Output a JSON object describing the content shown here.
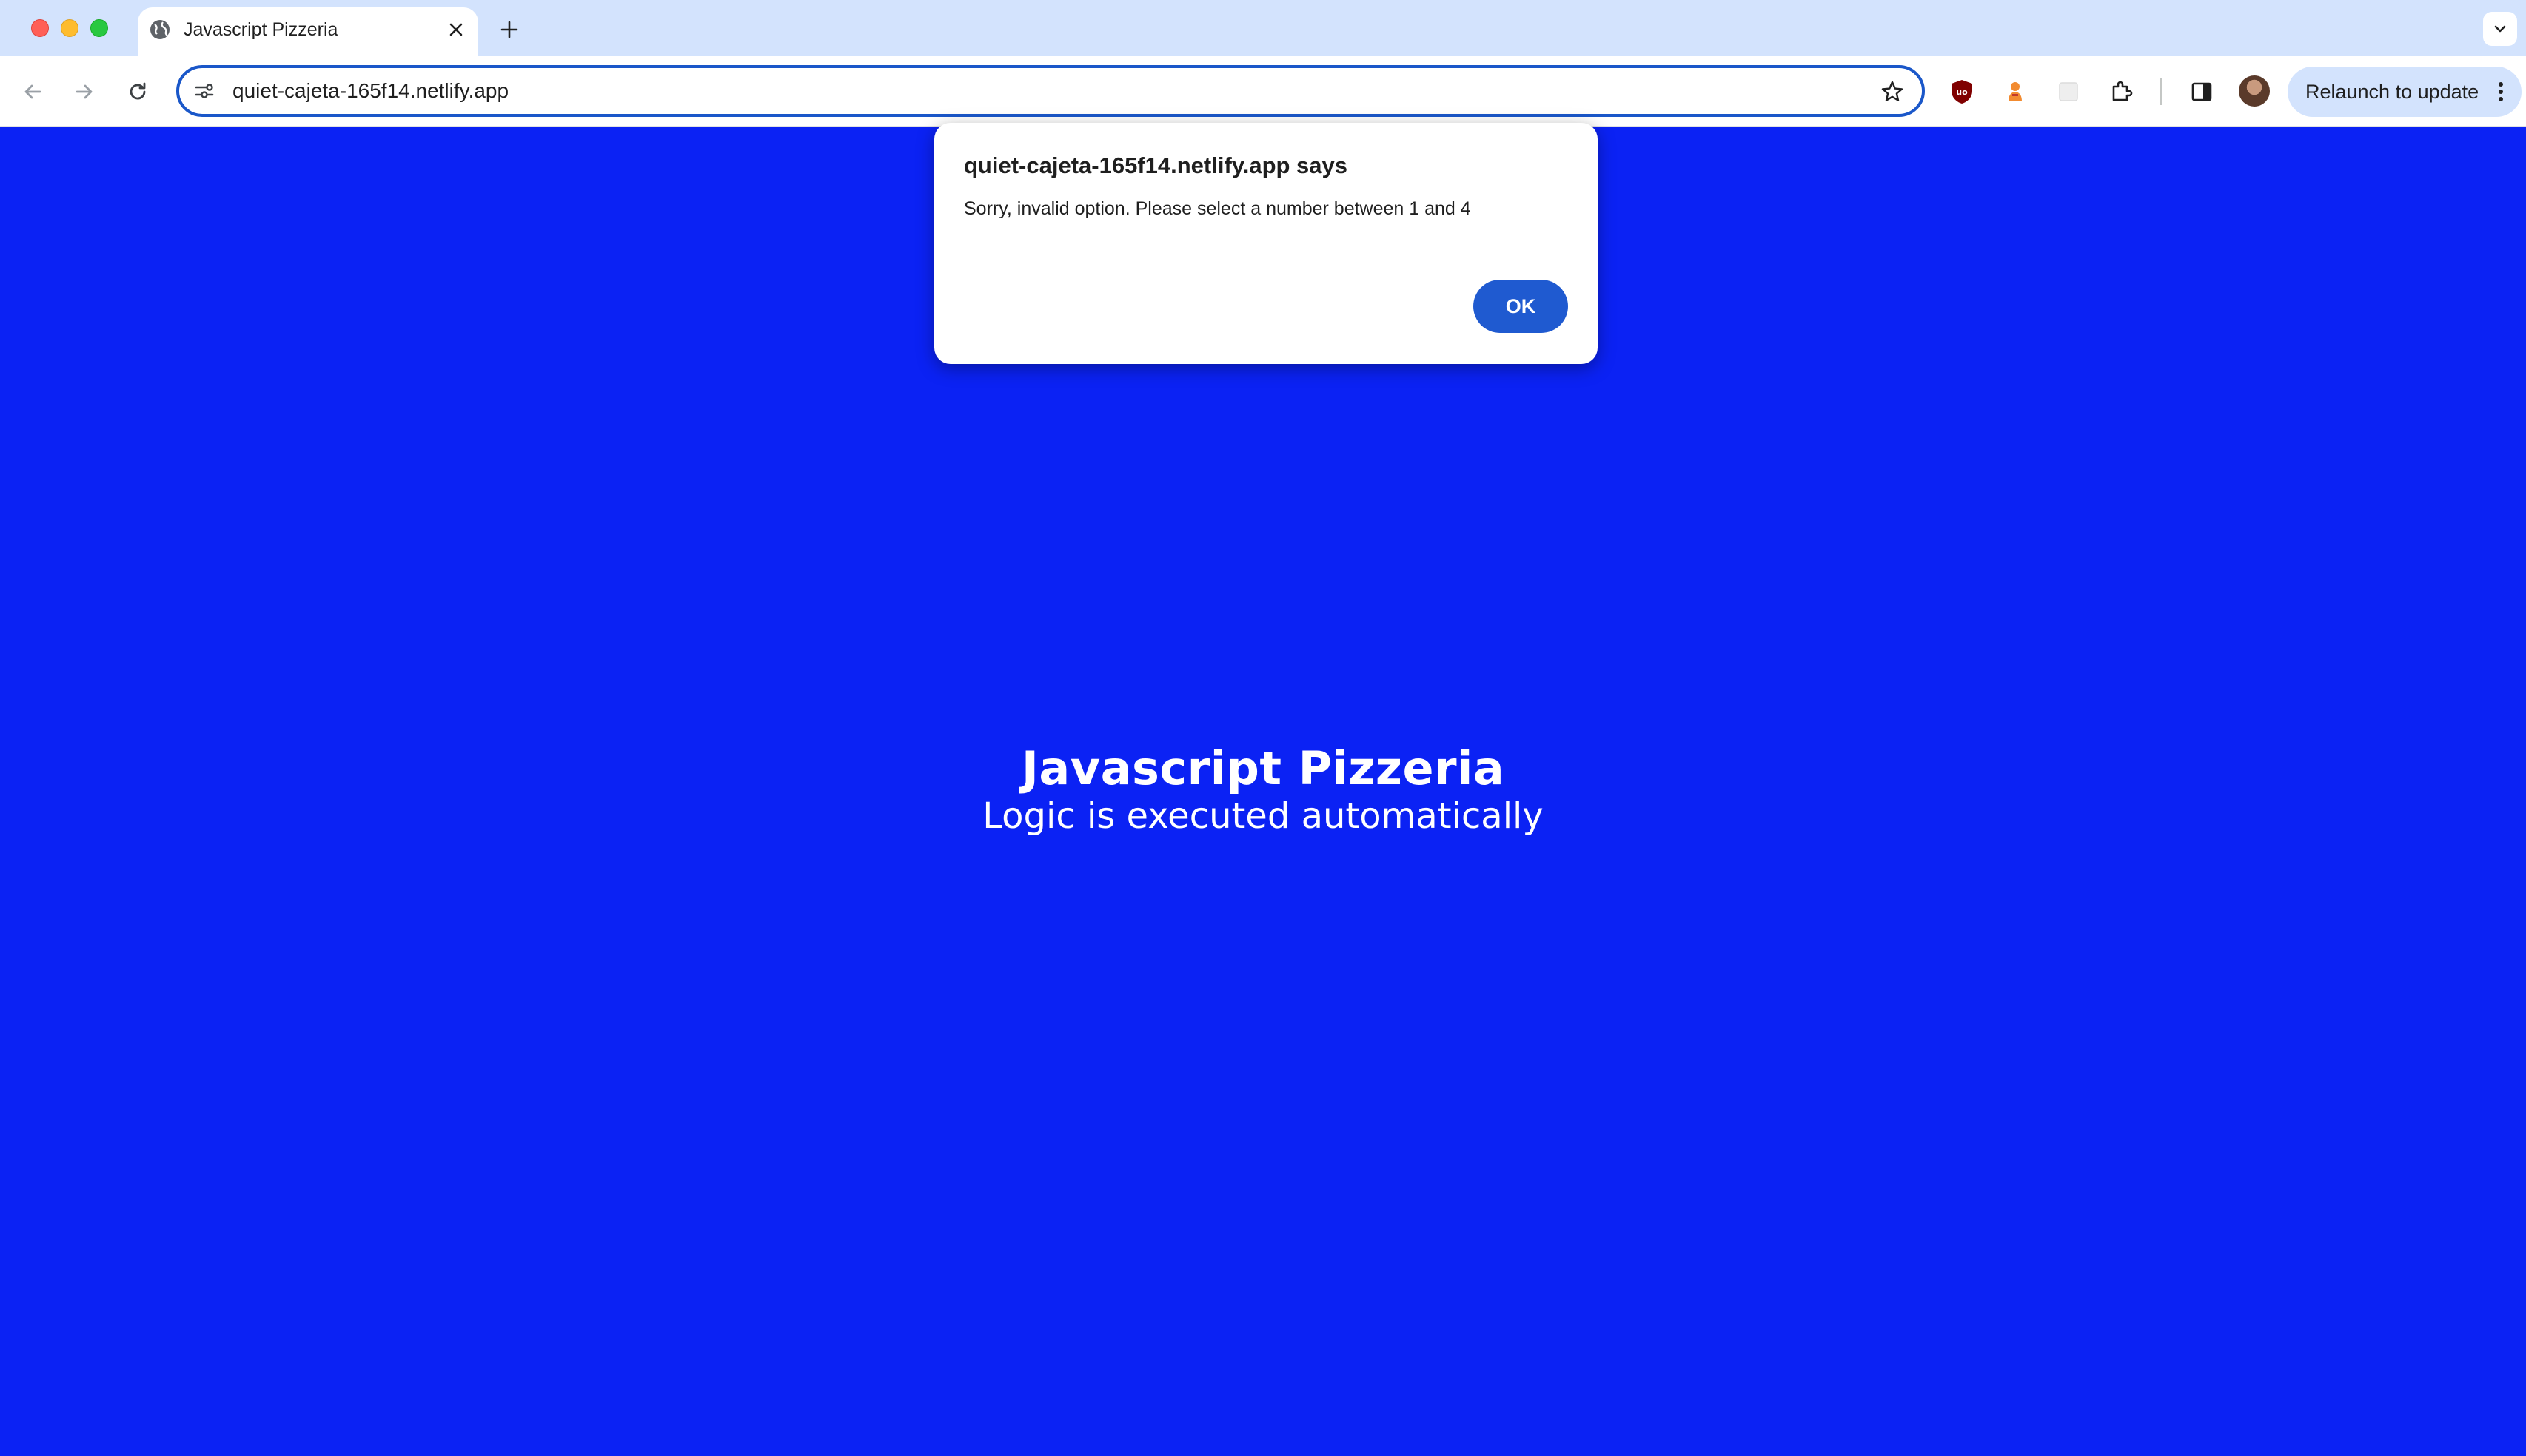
{
  "browser": {
    "tab": {
      "title": "Javascript Pizzeria",
      "favicon": "globe-icon"
    },
    "address_bar": {
      "url": "quiet-cajeta-165f14.netlify.app"
    },
    "relaunch_label": "Relaunch to update",
    "colors": {
      "tabstrip": "#d3e3fd",
      "omnibox_border": "#1a57c9",
      "ublock": "#800000"
    }
  },
  "page": {
    "title": "Javascript Pizzeria",
    "subtitle": "Logic is executed automatically",
    "background": "#0b22f4"
  },
  "dialog": {
    "title": "quiet-cajeta-165f14.netlify.app says",
    "message": "Sorry, invalid option. Please select a number between 1 and 4",
    "ok_label": "OK",
    "ok_color": "#1f5ad0"
  }
}
